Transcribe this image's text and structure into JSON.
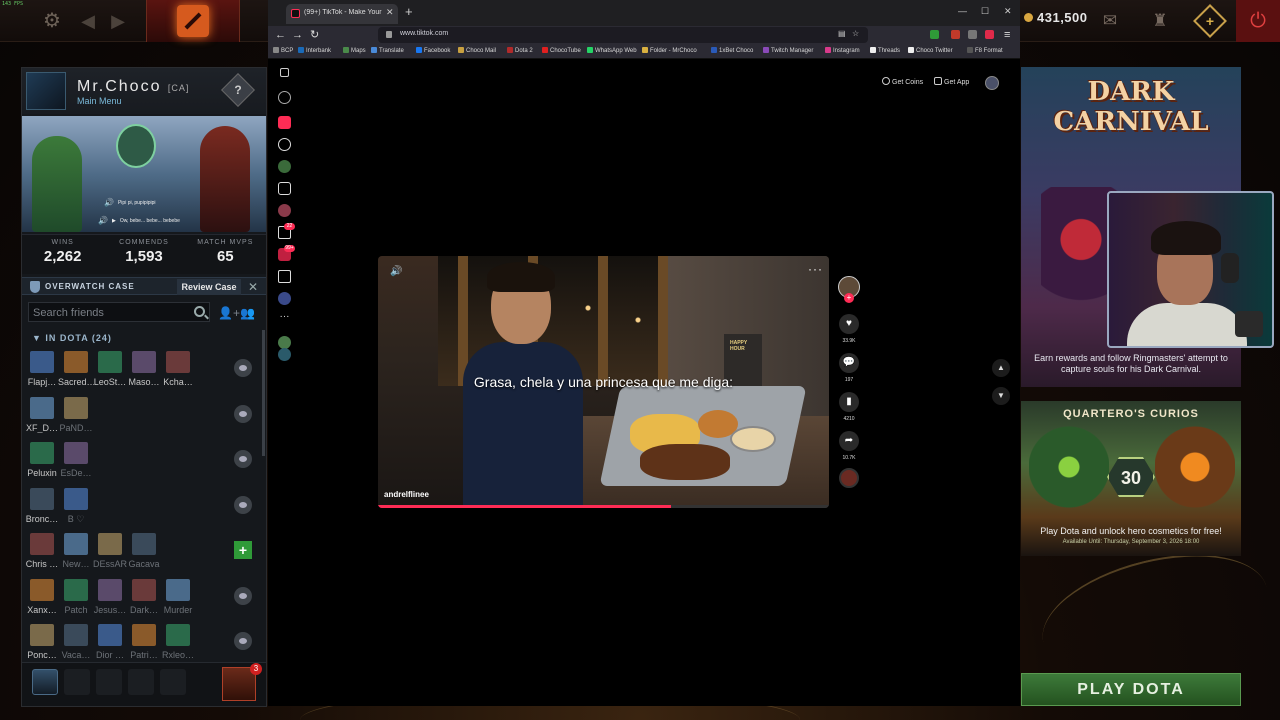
{
  "fps": "143 FPS",
  "top_bar": {
    "gold": "431,500"
  },
  "profile": {
    "name": "Mr.Choco",
    "tag": "[CA]",
    "subtitle": "Main Menu",
    "rank_glyph": "?",
    "audio_lines": [
      "Pipi pi, pupipipipi",
      "Ow, bebe... bebe... bebebe"
    ],
    "stats": [
      {
        "label": "WINS",
        "value": "2,262"
      },
      {
        "label": "COMMENDS",
        "value": "1,593"
      },
      {
        "label": "MATCH MVPS",
        "value": "65"
      }
    ]
  },
  "overwatch": {
    "label": "OVERWATCH CASE",
    "button": "Review Case",
    "close": "✕"
  },
  "friends": {
    "search_placeholder": "Search friends",
    "group_header": "IN DOTA (24)",
    "rows": [
      {
        "names": [
          "Flapj…",
          "Sacred…",
          "LeoSt…",
          "Maso…",
          "Kcha…"
        ],
        "action": "eye"
      },
      {
        "names": [
          "XF_D…",
          "PaND…"
        ],
        "action": "eye"
      },
      {
        "names": [
          "Peluxin",
          "EsDe…"
        ],
        "action": "eye"
      },
      {
        "names": [
          "Bronc…",
          "B ♡"
        ],
        "action": "eye"
      },
      {
        "names": [
          "Chris …",
          "New…",
          "DEssAR",
          "Gacava"
        ],
        "action": "plus"
      },
      {
        "names": [
          "Xanx…",
          "Patch",
          "Jesus…",
          "Dark…",
          "Murder"
        ],
        "action": "eye"
      },
      {
        "names": [
          "Ponc…",
          "Vaca…",
          "Dior …",
          "Patri…",
          "Rxleo…"
        ],
        "action": "eye"
      }
    ],
    "invite_count": "3"
  },
  "browser": {
    "tab_title": "(99+) TikTok - Make Your Day",
    "new_tab": "+",
    "url": "www.tiktok.com",
    "bookmarks": [
      "BCP",
      "Interbank",
      "Maps",
      "Translate",
      "Facebook",
      "Choco Mail",
      "Dota 2",
      "ChocoTube",
      "WhatsApp Web",
      "Folder - MrChoco",
      "1xBet Choco",
      "Twitch Manager",
      "Instagram",
      "Threads",
      "Choco Twitter",
      "F8 Format"
    ]
  },
  "tiktok": {
    "get_coins": "Get Coins",
    "get_app": "Get App",
    "sidebar_badges": [
      "22",
      "99+"
    ],
    "caption": "Grasa, chela y una princesa que me diga:",
    "author": "andrelflinee",
    "menu_sign": "HAPPY HOUR",
    "likes": "33.9K",
    "comments": "197",
    "saves": "4210",
    "shares": "10.7K",
    "progress": 0.65
  },
  "events": {
    "carnival_title": "DARK CARNIVAL",
    "carnival_desc": "Earn rewards and follow Ringmasters' attempt to capture souls for his Dark Carnival.",
    "curios_title": "QUARTERO'S CURIOS",
    "curios_level": "30",
    "curios_desc": "Play Dota and unlock hero cosmetics for free!",
    "curios_avail": "Available Until:  Thursday, September 3, 2026 18:00"
  },
  "play_button": "PLAY DOTA",
  "colors": {
    "tiktok_accent": "#fe2c55",
    "play_green": "#3d7a3a",
    "dota_red": "#5a1410"
  }
}
